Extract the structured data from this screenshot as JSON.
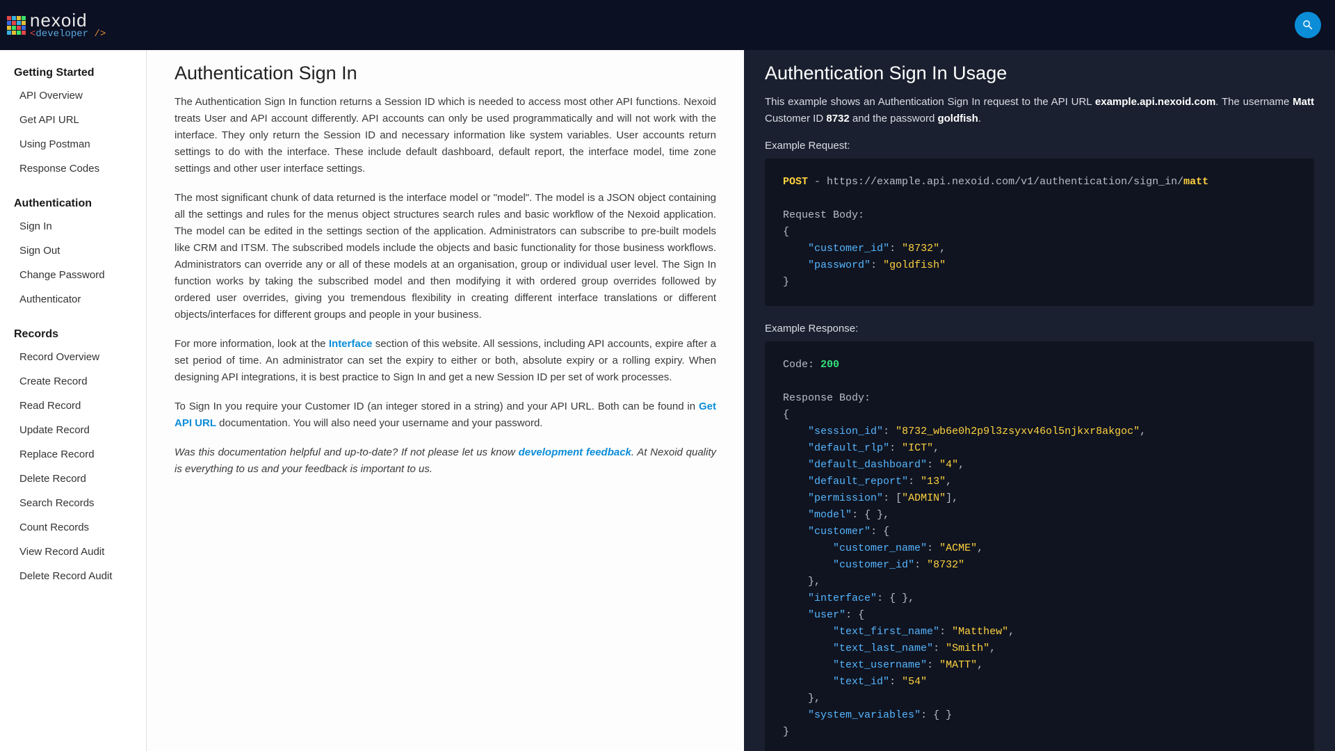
{
  "brand": {
    "name": "nexoid",
    "tagline_open": "<",
    "tagline_word": "developer",
    "tagline_close": " />"
  },
  "sidebar": {
    "sections": [
      {
        "title": "Getting Started",
        "items": [
          "API Overview",
          "Get API URL",
          "Using Postman",
          "Response Codes"
        ]
      },
      {
        "title": "Authentication",
        "items": [
          "Sign In",
          "Sign Out",
          "Change Password",
          "Authenticator"
        ]
      },
      {
        "title": "Records",
        "items": [
          "Record Overview",
          "Create Record",
          "Read Record",
          "Update Record",
          "Replace Record",
          "Delete Record",
          "Search Records",
          "Count Records",
          "View Record Audit",
          "Delete Record Audit"
        ]
      }
    ]
  },
  "content": {
    "title": "Authentication Sign In",
    "p1": "The Authentication Sign In function returns a Session ID which is needed to access most other API functions. Nexoid treats User and API account differently. API accounts can only be used programmatically and will not work with the interface. They only return the Session ID and necessary information like system variables. User accounts return settings to do with the interface. These include default dashboard, default report, the interface model, time zone settings and other user interface settings.",
    "p2": "The most significant chunk of data returned is the interface model or \"model\". The model is a JSON object containing all the settings and rules for the menus object structures search rules and basic workflow of the Nexoid application. The model can be edited in the settings section of the application. Administrators can subscribe to pre-built models like CRM and ITSM. The subscribed models include the objects and basic functionality for those business workflows. Administrators can override any or all of these models at an organisation, group or individual user level. The Sign In function works by taking the subscribed model and then modifying it with ordered group overrides followed by ordered user overrides, giving you tremendous flexibility in creating different interface translations or different objects/interfaces for different groups and people in your business.",
    "p3a": "For more information, look at the ",
    "p3_link": "Interface",
    "p3b": " section of this website. All sessions, including API accounts, expire after a set period of time. An administrator can set the expiry to either or both, absolute expiry or a rolling expiry. When designing API integrations, it is best practice to Sign In and get a new Session ID per set of work processes.",
    "p4a": "To Sign In you require your Customer ID (an integer stored in a string) and your API URL. Both can be found in ",
    "p4_link": "Get API URL",
    "p4b": " documentation. You will also need your username and your password.",
    "fb_a": "Was this documentation helpful and up-to-date? If not please let us know ",
    "fb_link": "development feedback",
    "fb_b": ". At Nexoid quality is everything to us and your feedback is important to us."
  },
  "usage": {
    "title": "Authentication Sign In Usage",
    "intro_a": "This example shows an Authentication Sign In request to the API URL ",
    "intro_url": "example.api.nexoid.com",
    "intro_b": ". The username ",
    "intro_user": "Matt",
    "intro_c": " Customer ID ",
    "intro_cid": "8732",
    "intro_d": " and the password ",
    "intro_pw": "goldfish",
    "intro_e": ".",
    "req_label": "Example Request:",
    "req": {
      "method": "POST",
      "dash": " - ",
      "url_pre": "https://example.api.nexoid.com/v1/authentication/sign_in/",
      "url_user": "matt",
      "body_label": "Request Body:",
      "body_keys": {
        "customer_id": "customer_id",
        "password": "password"
      },
      "body_vals": {
        "customer_id": "8732",
        "password": "goldfish"
      }
    },
    "resp_label": "Example Response:",
    "resp": {
      "code_label": "Code: ",
      "code": "200",
      "body_label": "Response Body:",
      "k": {
        "session_id": "session_id",
        "default_rlp": "default_rlp",
        "default_dashboard": "default_dashboard",
        "default_report": "default_report",
        "permission": "permission",
        "model": "model",
        "customer": "customer",
        "customer_name": "customer_name",
        "customer_id": "customer_id",
        "interface": "interface",
        "user": "user",
        "text_first_name": "text_first_name",
        "text_last_name": "text_last_name",
        "text_username": "text_username",
        "text_id": "text_id",
        "system_variables": "system_variables"
      },
      "v": {
        "session_id": "8732_wb6e0h2p9l3zsyxv46ol5njkxr8akgoc",
        "default_rlp": "ICT",
        "default_dashboard": "4",
        "default_report": "13",
        "permission": "ADMIN",
        "customer_name": "ACME",
        "customer_id": "8732",
        "text_first_name": "Matthew",
        "text_last_name": "Smith",
        "text_username": "MATT",
        "text_id": "54"
      }
    }
  }
}
